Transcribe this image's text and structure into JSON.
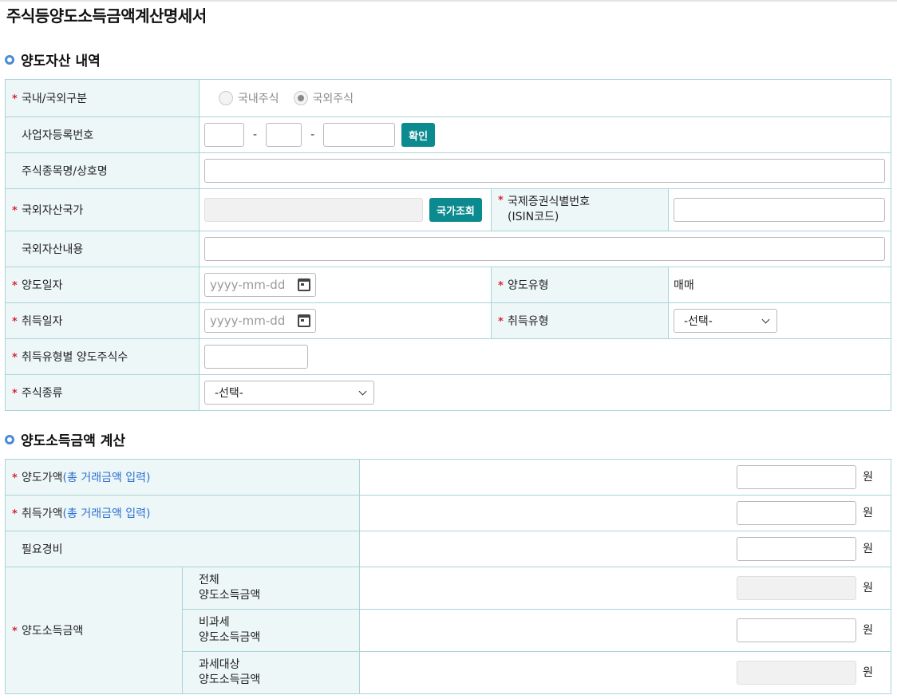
{
  "page": {
    "title": "주식등양도소득금액계산명세서"
  },
  "section1": {
    "title": "양도자산 내역",
    "market_type": {
      "label": "국내/국외구분",
      "options": [
        "국내주식",
        "국외주식"
      ],
      "selected": "국외주식"
    },
    "biz_reg_no": {
      "label": "사업자등록번호",
      "dash": "-",
      "confirm_button": "확인"
    },
    "stock_name": {
      "label": "주식종목명/상호명"
    },
    "foreign_country": {
      "label": "국외자산국가",
      "lookup_button": "국가조회"
    },
    "isin": {
      "label_line1": "국제증권식별번호",
      "label_line2": "(ISIN코드)"
    },
    "foreign_content": {
      "label": "국외자산내용"
    },
    "transfer_date": {
      "label": "양도일자",
      "placeholder": "yyyy-mm-dd"
    },
    "transfer_type": {
      "label": "양도유형",
      "value": "매매"
    },
    "acquire_date": {
      "label": "취득일자",
      "placeholder": "yyyy-mm-dd"
    },
    "acquire_type": {
      "label": "취득유형",
      "selected": "-선택-"
    },
    "share_count": {
      "label": "취득유형별 양도주식수"
    },
    "stock_kind": {
      "label": "주식종류",
      "selected": "-선택-"
    }
  },
  "section2": {
    "title": "양도소득금액 계산",
    "note": "(총 거래금액 입력)",
    "unit": "원",
    "transfer_price": {
      "label": "양도가액"
    },
    "acquire_price": {
      "label": "취득가액"
    },
    "expenses": {
      "label": "필요경비"
    },
    "income": {
      "label": "양도소득금액",
      "rows": [
        {
          "line1": "전체",
          "line2": "양도소득금액"
        },
        {
          "line1": "비과세",
          "line2": "양도소득금액"
        },
        {
          "line1": "과세대상",
          "line2": "양도소득금액"
        }
      ]
    }
  },
  "required_mark": "*",
  "colors": {
    "accent": "#0b8a8f",
    "border": "#a9d4d9",
    "label_bg": "#eef7f7",
    "required": "#d6263b",
    "link": "#2a6fd1"
  }
}
